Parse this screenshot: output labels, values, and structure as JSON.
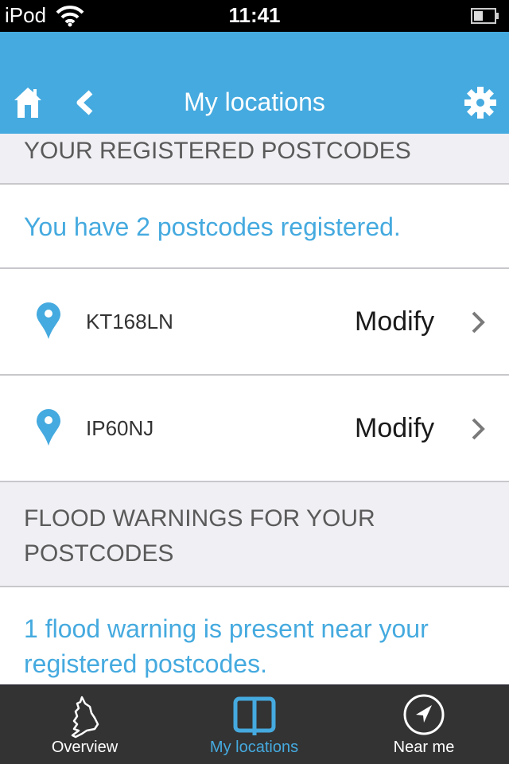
{
  "status_bar": {
    "device": "iPod",
    "time": "11:41",
    "wifi_icon": "wifi-icon",
    "battery_icon": "battery-icon"
  },
  "nav": {
    "title": "My locations",
    "home_icon": "home-icon",
    "back_icon": "chevron-left-icon",
    "settings_icon": "gear-icon"
  },
  "sections": {
    "registered_header": "YOUR REGISTERED POSTCODES",
    "registered_info": "You have 2 postcodes registered.",
    "warnings_header": "FLOOD WARNINGS FOR YOUR POSTCODES",
    "warnings_info": "1 flood warning is present near your registered postcodes."
  },
  "postcodes": [
    {
      "code": "KT168LN",
      "action": "Modify"
    },
    {
      "code": "IP60NJ",
      "action": "Modify"
    }
  ],
  "tabs": [
    {
      "label": "Overview",
      "icon": "map-outline-icon",
      "active": false
    },
    {
      "label": "My locations",
      "icon": "book-icon",
      "active": true
    },
    {
      "label": "Near me",
      "icon": "navigation-arrow-icon",
      "active": false
    }
  ],
  "colors": {
    "accent": "#45aadf",
    "tabbar": "#333333",
    "section_bg": "#efeff4"
  }
}
